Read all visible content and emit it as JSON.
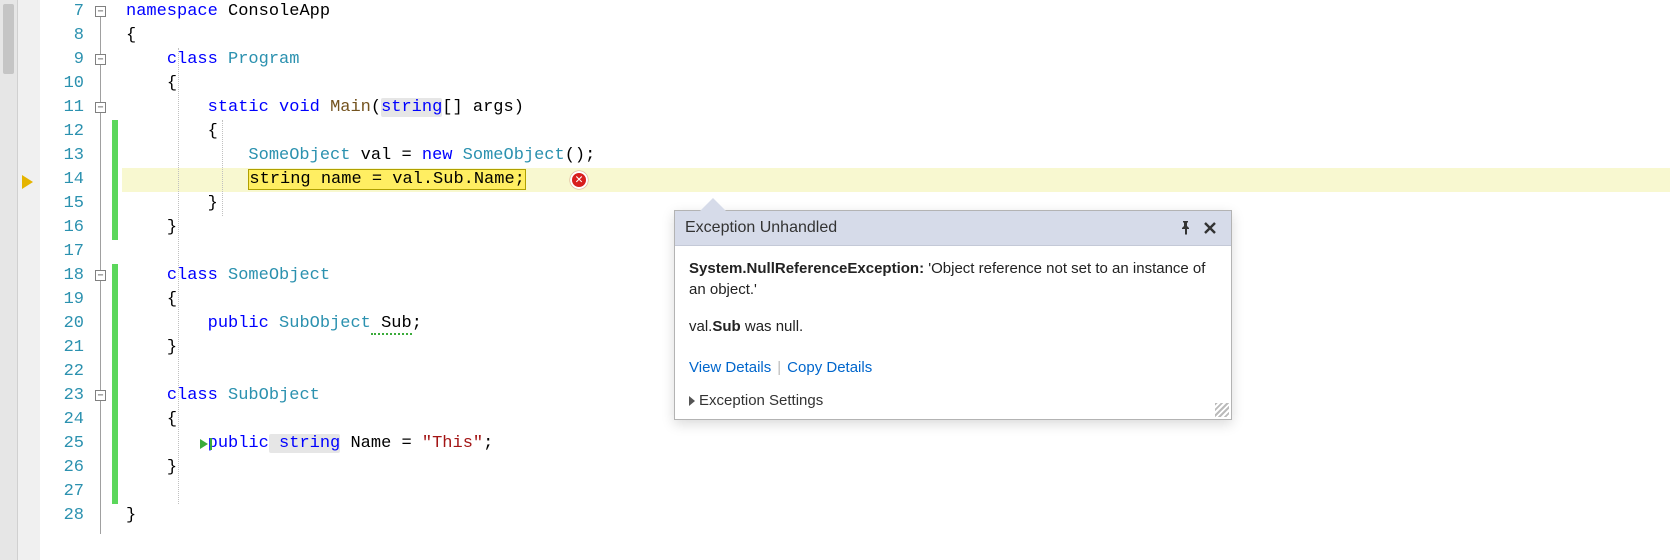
{
  "line_start": 7,
  "line_count": 22,
  "current_line": 14,
  "code": {
    "l7": {
      "kw_namespace": "namespace",
      "ns": "ConsoleApp"
    },
    "l8": {
      "open": "{"
    },
    "l9": {
      "kw_class": "class",
      "cls": "Program"
    },
    "l10": {
      "open": "{"
    },
    "l11": {
      "kw_static": "static",
      "kw_void": "void",
      "method": "Main",
      "lp": "(",
      "ptype": "string",
      "arr": "[]",
      "pname": " args",
      "rp": ")"
    },
    "l12": {
      "open": "{"
    },
    "l13": {
      "type": "SomeObject",
      "var": " val ",
      "eq": "= ",
      "kw_new": "new",
      "ctor": " SomeObject",
      "tail": "();"
    },
    "l14": {
      "hl": "string name = val.Sub.Name;"
    },
    "l15": {
      "close": "}"
    },
    "l16": {
      "close": "}"
    },
    "l17": {
      "blank": ""
    },
    "l18": {
      "kw_class": "class",
      "cls": "SomeObject"
    },
    "l19": {
      "open": "{"
    },
    "l20": {
      "kw_pub": "public",
      "type": " SubObject",
      "name": " Sub",
      "semi": ";"
    },
    "l21": {
      "close": "}"
    },
    "l22": {
      "blank": ""
    },
    "l23": {
      "kw_class": "class",
      "cls": "SubObject"
    },
    "l24": {
      "open": "{"
    },
    "l25": {
      "kw_pub": "public",
      "type": " string",
      "name": " Name ",
      "eq": "= ",
      "str": "\"This\"",
      "semi": ";"
    },
    "l26": {
      "close": "}"
    },
    "l27": {
      "blank": ""
    },
    "l28": {
      "close": "}"
    }
  },
  "changed_ranges": [
    {
      "from": 12,
      "to": 16
    },
    {
      "from": 18,
      "to": 27
    }
  ],
  "fold_markers": [
    7,
    9,
    11,
    18,
    23
  ],
  "exception": {
    "title": "Exception Unhandled",
    "type": "System.NullReferenceException:",
    "message": " 'Object reference not set to an instance of an object.'",
    "detail_prefix": "val.",
    "detail_bold": "Sub",
    "detail_suffix": " was null.",
    "view_details": "View Details",
    "copy_details": "Copy Details",
    "settings": "Exception Settings"
  }
}
